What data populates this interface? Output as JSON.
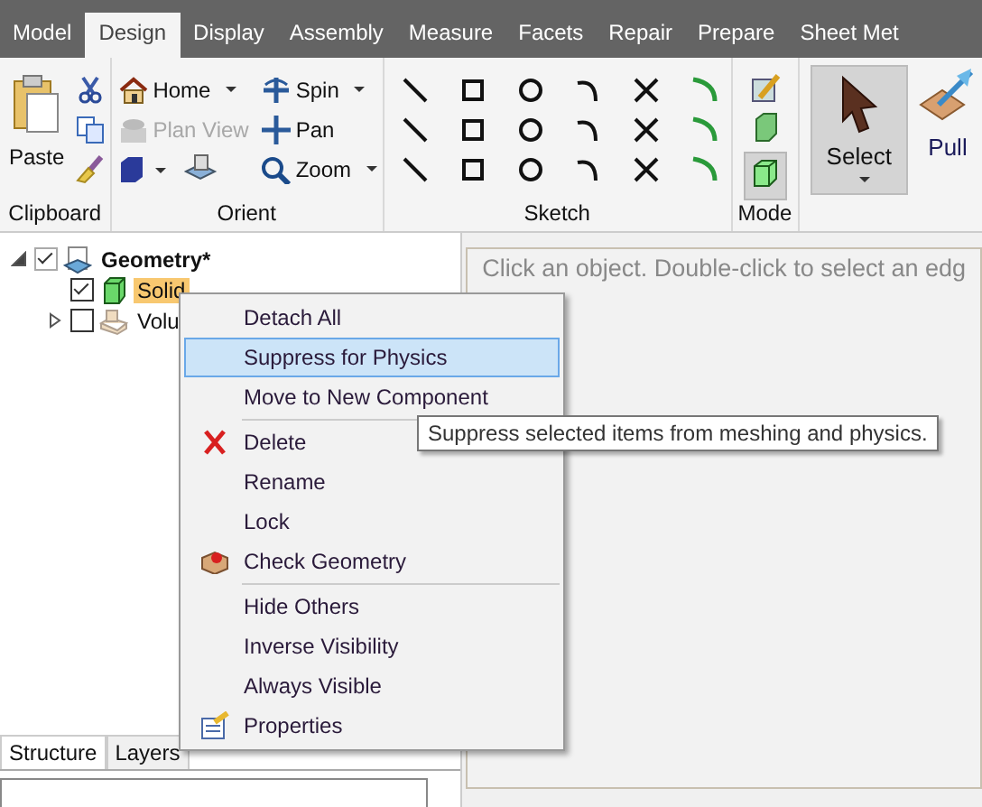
{
  "ribbon_tabs": [
    {
      "label": "Model",
      "selected": false
    },
    {
      "label": "Design",
      "selected": true
    },
    {
      "label": "Display",
      "selected": false
    },
    {
      "label": "Assembly",
      "selected": false
    },
    {
      "label": "Measure",
      "selected": false
    },
    {
      "label": "Facets",
      "selected": false
    },
    {
      "label": "Repair",
      "selected": false
    },
    {
      "label": "Prepare",
      "selected": false
    },
    {
      "label": "Sheet Met",
      "selected": false
    }
  ],
  "clipboard": {
    "paste": "Paste",
    "group_label": "Clipboard"
  },
  "orient": {
    "buttons": [
      {
        "label": "Home",
        "dropdown": true,
        "disabled": false
      },
      {
        "label": "Spin",
        "dropdown": true,
        "disabled": false
      },
      {
        "label": "Plan View",
        "dropdown": false,
        "disabled": true
      },
      {
        "label": "Pan",
        "dropdown": false,
        "disabled": false
      },
      {
        "label": "Zoom",
        "dropdown": true,
        "disabled": false
      }
    ],
    "group_label": "Orient"
  },
  "sketch": {
    "group_label": "Sketch"
  },
  "mode": {
    "group_label": "Mode"
  },
  "select": {
    "label": "Select",
    "selected": true,
    "dropdown": true
  },
  "pull": {
    "label": "Pull"
  },
  "tree": [
    {
      "label": "Geometry*",
      "checked": true,
      "expanded": true,
      "selected": false,
      "children": [
        {
          "label": "Solid",
          "checked": true,
          "selected": true
        },
        {
          "label": "Volu",
          "checked": false,
          "expanded": false,
          "selected": false
        }
      ]
    }
  ],
  "panel_tabs": [
    {
      "label": "Structure",
      "selected": true
    },
    {
      "label": "Layers",
      "selected": false
    }
  ],
  "viewport_hint": "Click an object. Double-click to select an edg",
  "context_menu": [
    {
      "label": "Detach All",
      "selected": false,
      "separator": false
    },
    {
      "label": "Suppress for Physics",
      "selected": true,
      "separator": false
    },
    {
      "label": "Move to New Component",
      "selected": false,
      "separator": false
    },
    {
      "label": "Delete",
      "selected": false,
      "separator": true
    },
    {
      "label": "Rename",
      "selected": false,
      "separator": false
    },
    {
      "label": "Lock",
      "selected": false,
      "separator": false
    },
    {
      "label": "Check Geometry",
      "selected": false,
      "separator": false
    },
    {
      "label": "Hide Others",
      "selected": false,
      "separator": true
    },
    {
      "label": "Inverse Visibility",
      "selected": false,
      "separator": false
    },
    {
      "label": "Always Visible",
      "selected": false,
      "separator": false
    },
    {
      "label": "Properties",
      "selected": false,
      "separator": false
    }
  ],
  "tooltip": "Suppress selected items from meshing and physics."
}
